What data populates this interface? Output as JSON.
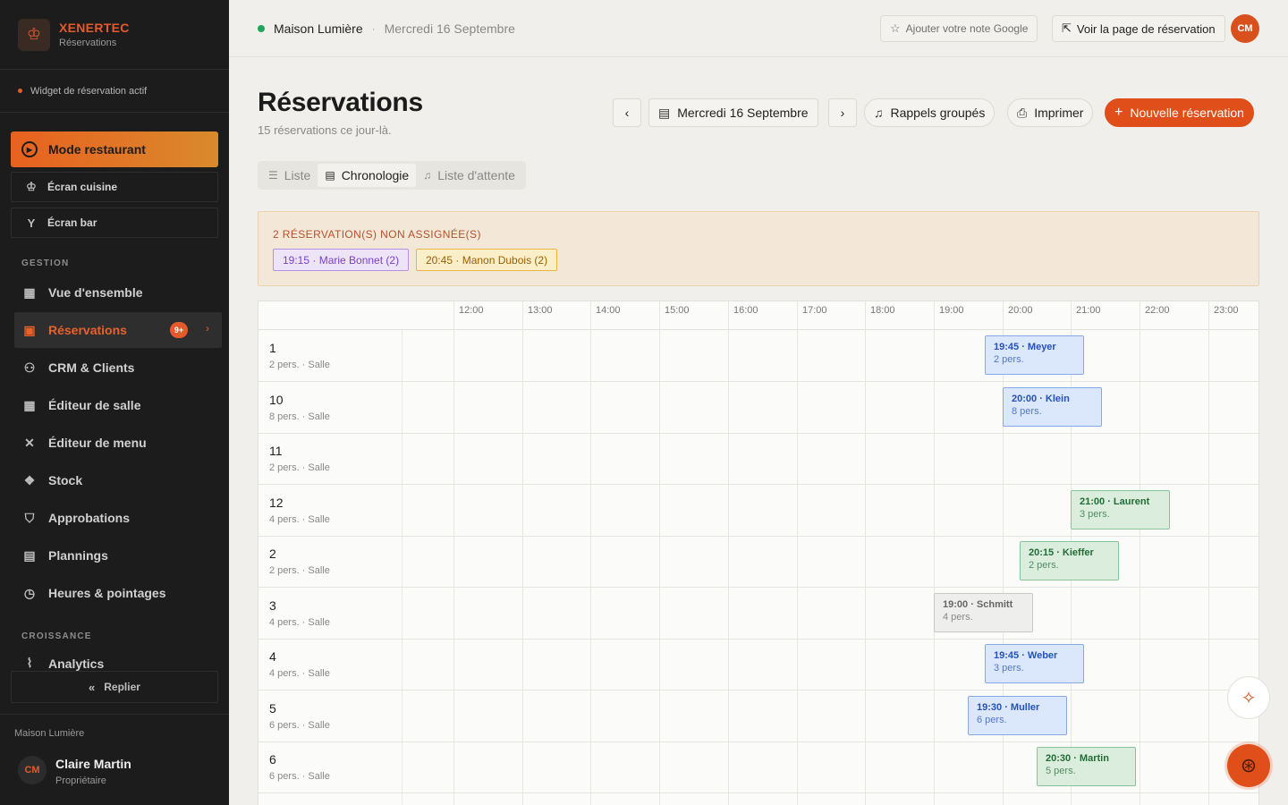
{
  "brand": {
    "name": "XENERTEC",
    "sub": "Réservations"
  },
  "widget_status": "Widget de réservation actif",
  "mode_button": "Mode restaurant",
  "screens": [
    "Écran cuisine",
    "Écran bar"
  ],
  "sections": {
    "gestion": "GESTION",
    "croissance": "CROISSANCE"
  },
  "nav": [
    {
      "label": "Vue d'ensemble"
    },
    {
      "label": "Réservations",
      "badge": "9+"
    },
    {
      "label": "CRM & Clients"
    },
    {
      "label": "Éditeur de salle"
    },
    {
      "label": "Éditeur de menu"
    },
    {
      "label": "Stock"
    },
    {
      "label": "Approbations"
    },
    {
      "label": "Plannings"
    },
    {
      "label": "Heures & pointages"
    },
    {
      "label": "Analytics"
    }
  ],
  "collapse_label": "Replier",
  "footer": {
    "venue": "Maison Lumière",
    "initials": "CM",
    "name": "Claire Martin",
    "role": "Propriétaire"
  },
  "topbar": {
    "venue": "Maison Lumière",
    "separator": "·",
    "date": "Mercredi 16 Septembre",
    "google_btn": "Ajouter votre note Google",
    "booking_btn": "Voir la page de réservation",
    "avatar": "CM"
  },
  "header": {
    "title": "Réservations",
    "subtitle": "15 réservations ce jour-là.",
    "date": "Mercredi 16 Septembre",
    "reminders": "Rappels groupés",
    "print": "Imprimer",
    "new_reservation": "Nouvelle réservation"
  },
  "tabs": [
    "Liste",
    "Chronologie",
    "Liste d'attente"
  ],
  "unassigned": {
    "title": "2 RÉSERVATION(S) NON ASSIGNÉE(S)",
    "chips": [
      "19:15 · Marie Bonnet (2)",
      "20:45 · Manon Dubois (2)"
    ]
  },
  "timeline": {
    "hours": [
      "12:00",
      "13:00",
      "14:00",
      "15:00",
      "16:00",
      "17:00",
      "18:00",
      "19:00",
      "20:00",
      "21:00",
      "22:00",
      "23:00"
    ],
    "rows": [
      {
        "name": "1",
        "meta": "2 pers. · Salle",
        "res": {
          "title": "19:45 · Meyer",
          "sub": "2 pers.",
          "start": 19.75,
          "color": "blue"
        }
      },
      {
        "name": "10",
        "meta": "8 pers. · Salle",
        "res": {
          "title": "20:00 · Klein",
          "sub": "8 pers.",
          "start": 20.0,
          "color": "blue"
        }
      },
      {
        "name": "11",
        "meta": "2 pers. · Salle",
        "res": null
      },
      {
        "name": "12",
        "meta": "4 pers. · Salle",
        "res": {
          "title": "21:00 · Laurent",
          "sub": "3 pers.",
          "start": 21.0,
          "color": "green"
        }
      },
      {
        "name": "2",
        "meta": "2 pers. · Salle",
        "res": {
          "title": "20:15 · Kieffer",
          "sub": "2 pers.",
          "start": 20.25,
          "color": "green"
        }
      },
      {
        "name": "3",
        "meta": "4 pers. · Salle",
        "res": {
          "title": "19:00 · Schmitt",
          "sub": "4 pers.",
          "start": 19.0,
          "color": "gray"
        }
      },
      {
        "name": "4",
        "meta": "4 pers. · Salle",
        "res": {
          "title": "19:45 · Weber",
          "sub": "3 pers.",
          "start": 19.75,
          "color": "blue"
        }
      },
      {
        "name": "5",
        "meta": "6 pers. · Salle",
        "res": {
          "title": "19:30 · Muller",
          "sub": "6 pers.",
          "start": 19.5,
          "color": "blue"
        }
      },
      {
        "name": "6",
        "meta": "6 pers. · Salle",
        "res": {
          "title": "20:30 · Martin",
          "sub": "5 pers.",
          "start": 20.5,
          "color": "green"
        }
      }
    ]
  }
}
